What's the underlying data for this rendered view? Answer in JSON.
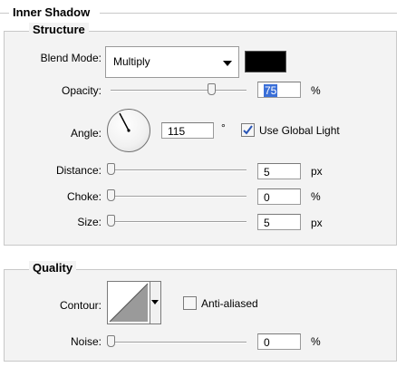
{
  "section": {
    "title": "Inner Shadow"
  },
  "structure": {
    "title": "Structure",
    "blend_mode": {
      "label": "Blend Mode:",
      "value": "Multiply",
      "color": "#000000"
    },
    "opacity": {
      "label": "Opacity:",
      "value": "75",
      "unit": "%",
      "slider_level": 0.75
    },
    "angle": {
      "label": "Angle:",
      "value": "115",
      "unit": "°",
      "use_global_light_label": "Use Global Light",
      "use_global_light_checked": true
    },
    "distance": {
      "label": "Distance:",
      "value": "5",
      "unit": "px",
      "slider_level": 0.0
    },
    "choke": {
      "label": "Choke:",
      "value": "0",
      "unit": "%",
      "slider_level": 0.0
    },
    "size": {
      "label": "Size:",
      "value": "5",
      "unit": "px",
      "slider_level": 0.0
    }
  },
  "quality": {
    "title": "Quality",
    "contour": {
      "label": "Contour:",
      "icon": "linear-contour-icon"
    },
    "anti_aliased": {
      "label": "Anti-aliased",
      "checked": false
    },
    "noise": {
      "label": "Noise:",
      "value": "0",
      "unit": "%",
      "slider_level": 0.0
    }
  },
  "colors": {
    "selection": "#3a6fd8",
    "check": "#2a55b5",
    "panel": "#f3f3f3"
  }
}
